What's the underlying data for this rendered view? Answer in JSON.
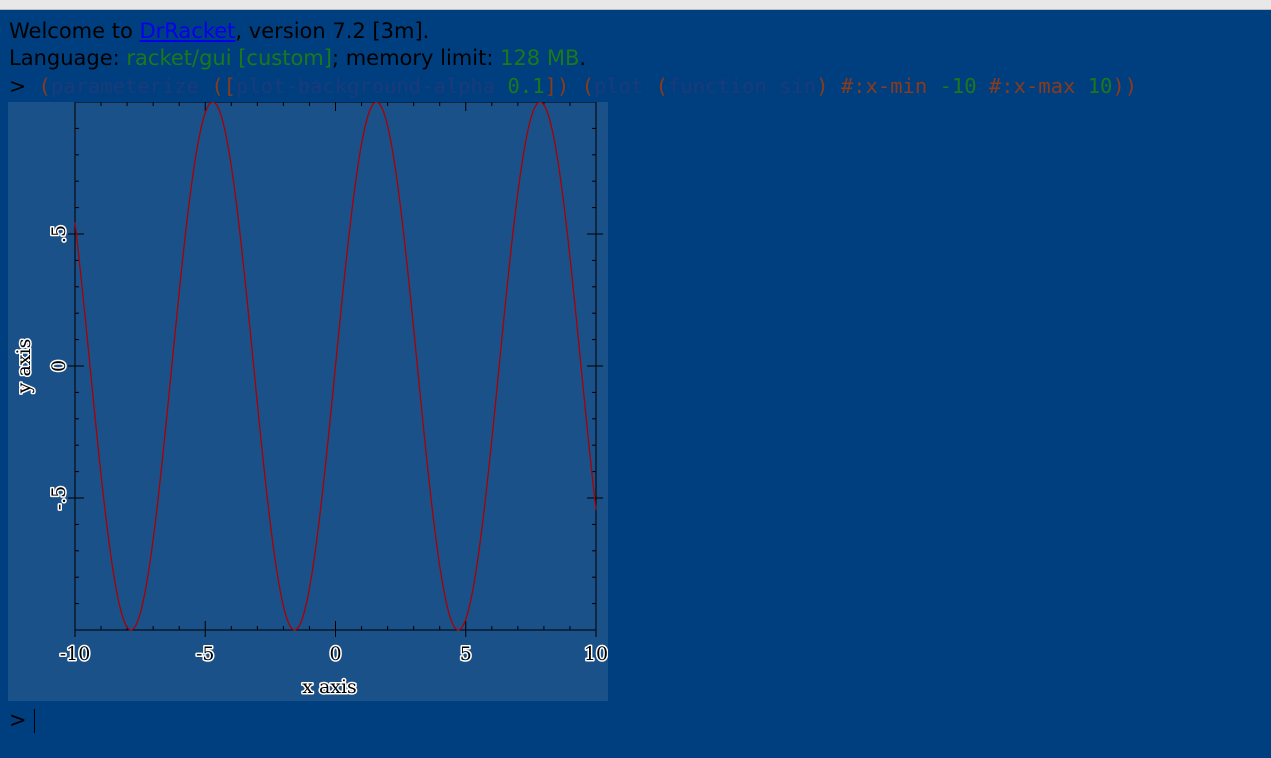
{
  "repl": {
    "welcome": {
      "prefix": "Welcome to ",
      "link": "DrRacket",
      "suffix": ", version 7.2 [3m]."
    },
    "language": {
      "label": "Language: ",
      "name": "racket/gui [custom]",
      "mid": "; memory limit: ",
      "limit": "128 MB",
      "end": "."
    },
    "input": {
      "prompt": ">",
      "tokens": [
        {
          "text": " (",
          "color": "#8b3a1a"
        },
        {
          "text": "parameterize",
          "color": "#1b3a7a"
        },
        {
          "text": " ([",
          "color": "#8b3a1a"
        },
        {
          "text": "plot-background-alpha",
          "color": "#1b3a7a"
        },
        {
          "text": " ",
          "color": "#000000"
        },
        {
          "text": "0.1",
          "color": "#1a7a1a"
        },
        {
          "text": "]) (",
          "color": "#8b3a1a"
        },
        {
          "text": "plot",
          "color": "#1b3a7a"
        },
        {
          "text": " (",
          "color": "#8b3a1a"
        },
        {
          "text": "function",
          "color": "#1b3a7a"
        },
        {
          "text": " ",
          "color": "#000000"
        },
        {
          "text": "sin",
          "color": "#1b3a7a"
        },
        {
          "text": ") #:x-min ",
          "color": "#8b3a1a"
        },
        {
          "text": "-10",
          "color": "#1a7a1a"
        },
        {
          "text": " #:x-max ",
          "color": "#8b3a1a"
        },
        {
          "text": "10",
          "color": "#1a7a1a"
        },
        {
          "text": "))",
          "color": "#8b3a1a"
        }
      ]
    },
    "next_prompt": ">"
  },
  "chart_data": {
    "type": "line",
    "function": "sin",
    "xlim": [
      -10,
      10
    ],
    "ylim": [
      -1,
      1
    ],
    "x_ticks": [
      -10,
      -5,
      0,
      5,
      10
    ],
    "x_tick_labels": [
      "-10",
      "-5",
      "0",
      "5",
      "10"
    ],
    "y_ticks": [
      -0.5,
      0,
      0.5
    ],
    "y_tick_labels": [
      "-.5",
      "0",
      ".5"
    ],
    "xlabel": "x axis",
    "ylabel": "y axis",
    "series": [
      {
        "color": "#aa0000"
      }
    ],
    "grid": false,
    "background": "#1b5189"
  }
}
